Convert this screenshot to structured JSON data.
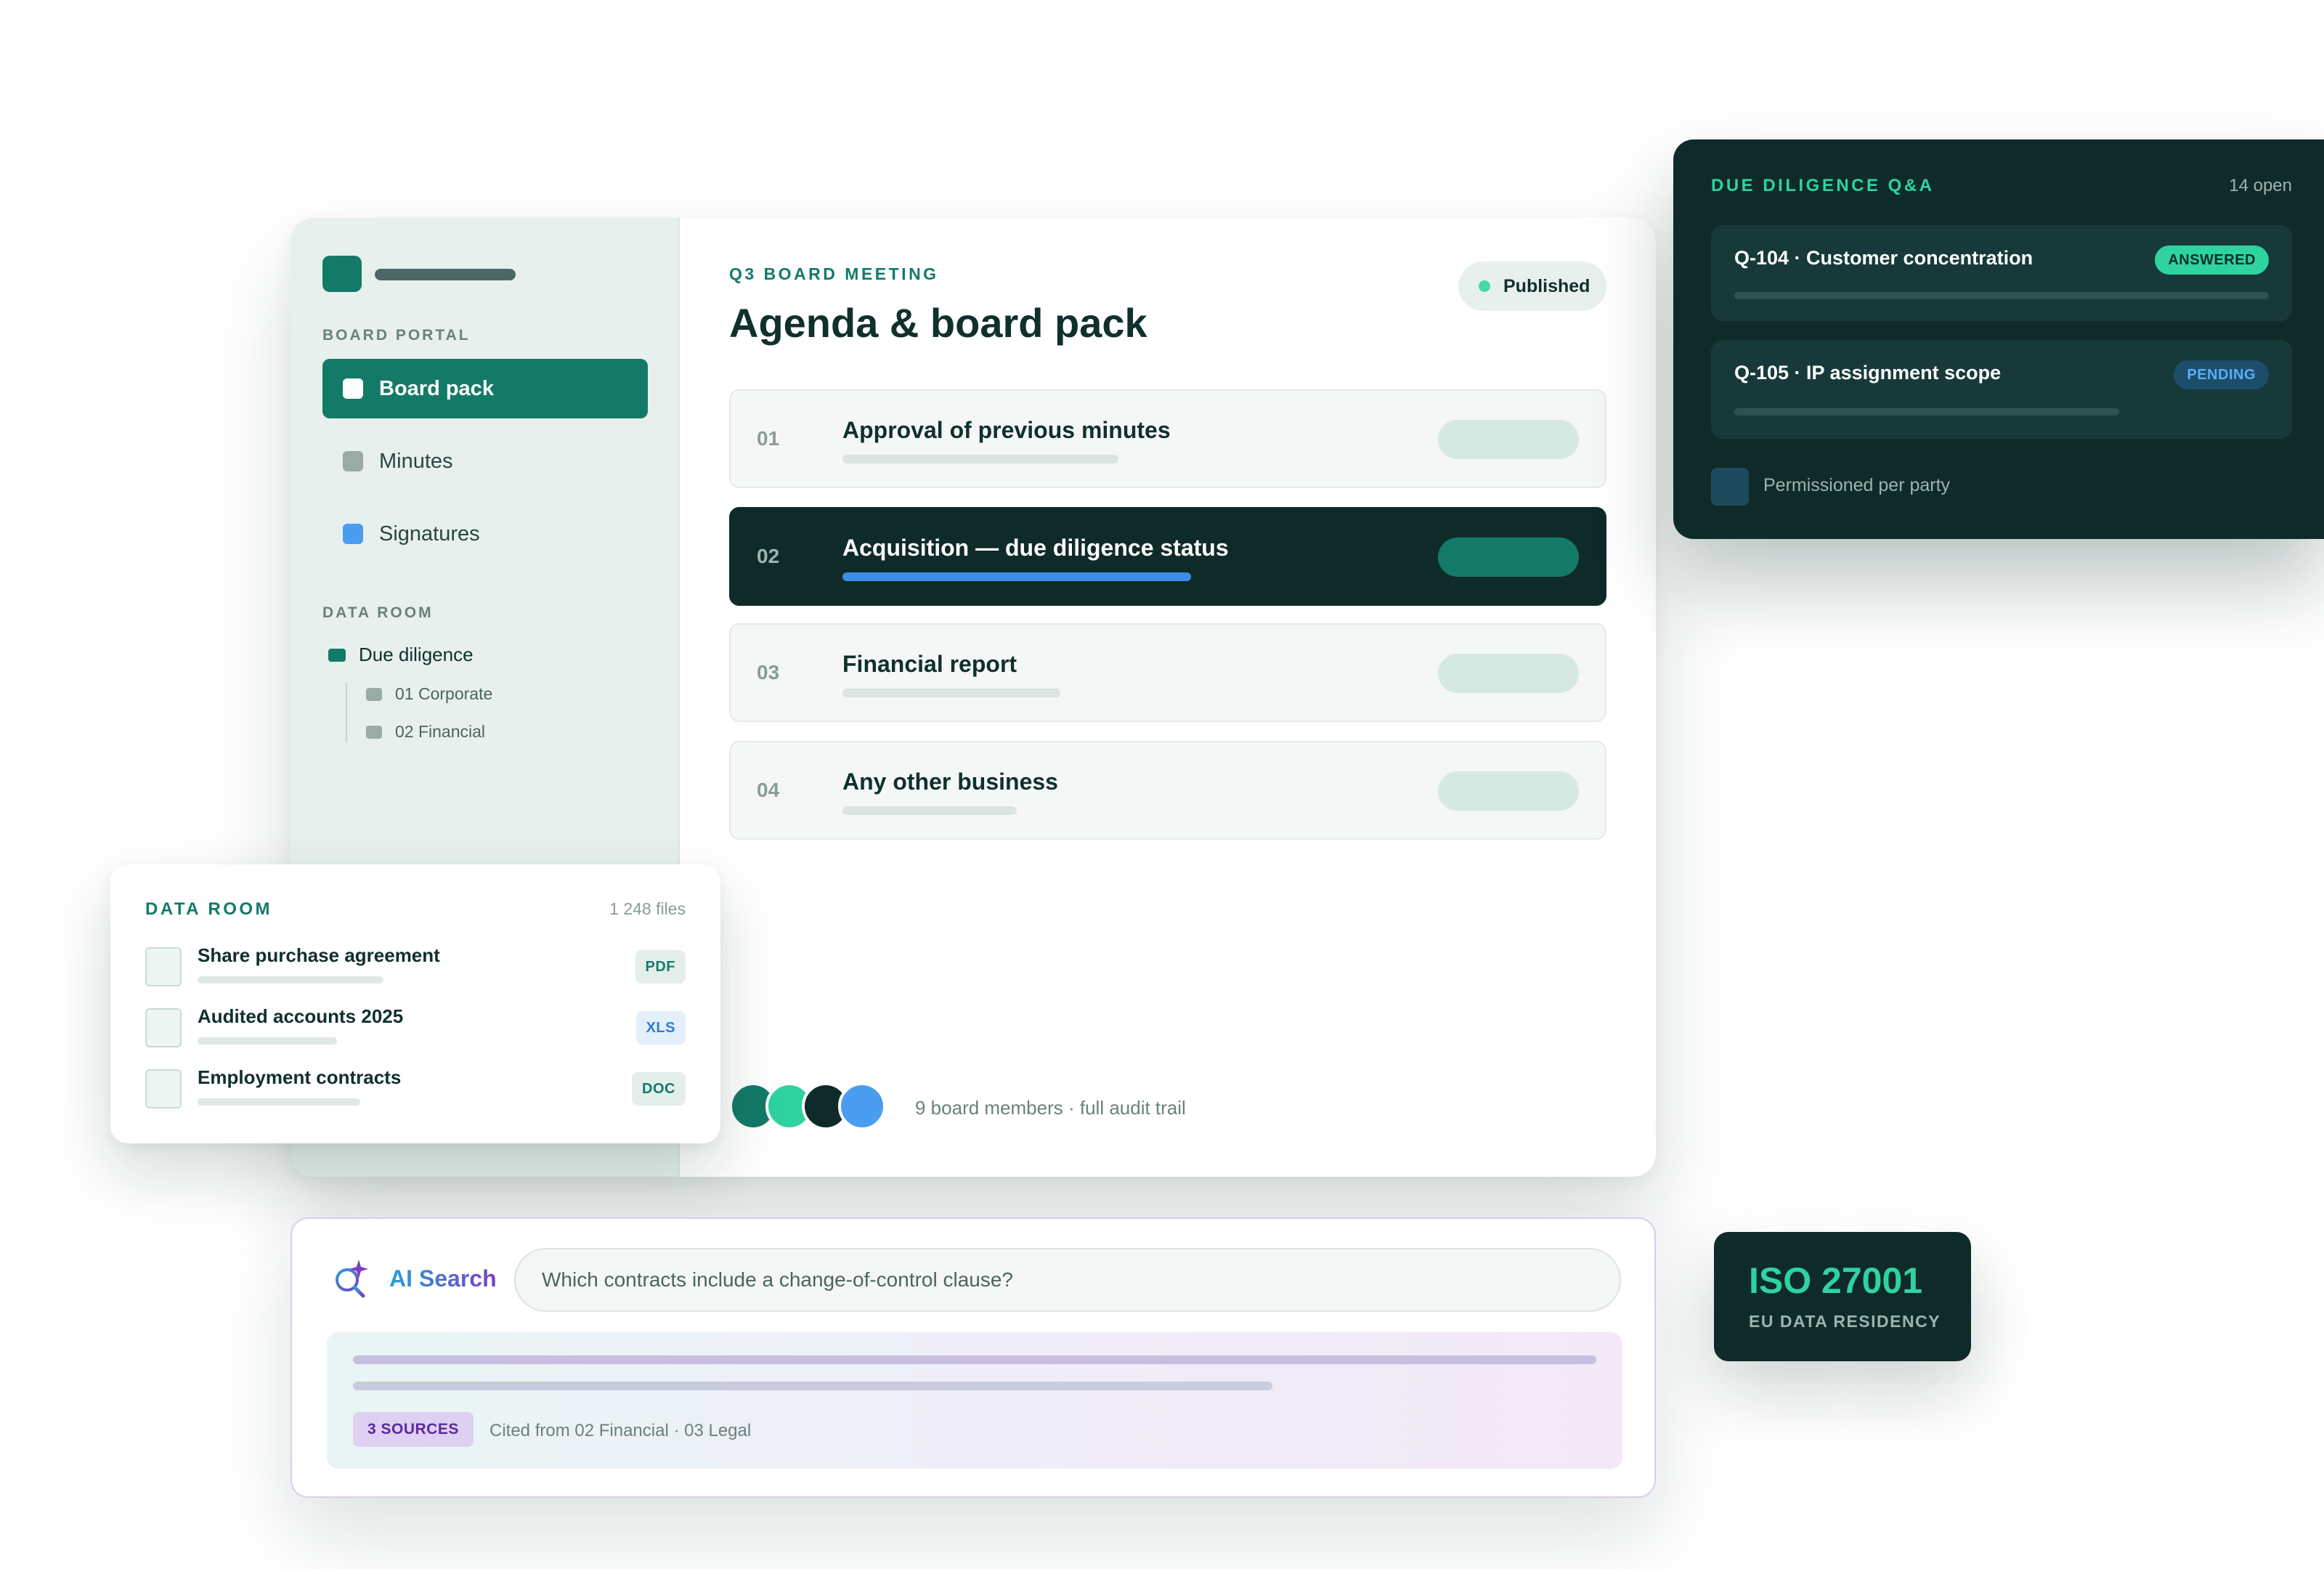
{
  "sidebar": {
    "section_portal": "BOARD PORTAL",
    "nav": [
      {
        "label": "Board pack",
        "dot_color": "#ffffff"
      },
      {
        "label": "Minutes",
        "dot_color": "#9aaaa7"
      },
      {
        "label": "Signatures",
        "dot_color": "#4a9df0"
      }
    ],
    "section_dataroom": "DATA ROOM",
    "tree": {
      "root": "Due diligence",
      "children": [
        "01 Corporate",
        "02 Financial"
      ]
    }
  },
  "main": {
    "eyebrow": "Q3 BOARD MEETING",
    "title": "Agenda & board pack",
    "status": "Published",
    "agenda": [
      {
        "num": "01",
        "title": "Approval of previous minutes"
      },
      {
        "num": "02",
        "title": "Acquisition — due diligence status"
      },
      {
        "num": "03",
        "title": "Financial report"
      },
      {
        "num": "04",
        "title": "Any other business"
      }
    ],
    "members_text": "9 board members · full audit trail",
    "avatar_colors": [
      "#137a68",
      "#2ed3a0",
      "#0f2b29",
      "#4a9df0"
    ]
  },
  "dd_panel": {
    "title": "DUE DILIGENCE Q&A",
    "count": "14 open",
    "questions": [
      {
        "title": "Q-104 · Customer concentration",
        "status": "ANSWERED"
      },
      {
        "title": "Q-105 · IP assignment scope",
        "status": "PENDING"
      }
    ],
    "footer": "Permissioned per party"
  },
  "dataroom": {
    "title": "DATA ROOM",
    "count": "1 248 files",
    "files": [
      {
        "name": "Share purchase agreement",
        "type": "PDF"
      },
      {
        "name": "Audited accounts 2025",
        "type": "XLS"
      },
      {
        "name": "Employment contracts",
        "type": "DOC"
      }
    ]
  },
  "ai_search": {
    "label": "AI Search",
    "query": "Which contracts include a change-of-control clause?",
    "sources_badge": "3 SOURCES",
    "cited": "Cited from 02 Financial · 03 Legal"
  },
  "iso": {
    "title": "ISO 27001",
    "subtitle": "EU DATA RESIDENCY"
  }
}
